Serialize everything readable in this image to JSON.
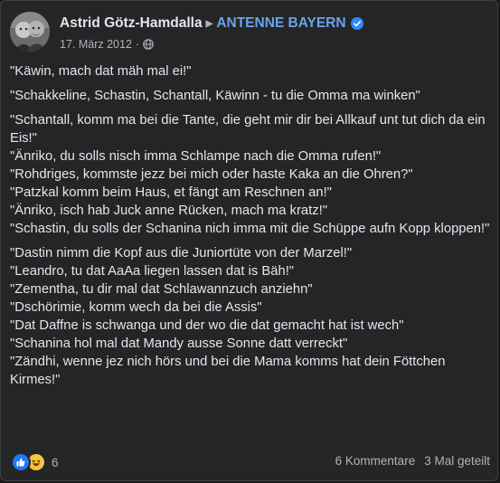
{
  "post": {
    "author": "Astrid Götz-Hamdalla",
    "target_page": "ANTENNE BAYERN",
    "date": "17. März 2012",
    "separator": "·",
    "arrow_icon": "triangle-right-icon",
    "verified_icon": "verified-badge-icon",
    "privacy_icon": "globe-icon",
    "colors": {
      "background": "#242526",
      "text": "#e4e6eb",
      "secondary_text": "#b0b3b8",
      "page_link": "#6aa3e8",
      "verified": "#2d88ff"
    }
  },
  "content": {
    "lines": [
      "\"Käwin, mach dat mäh mal ei!\"",
      "\"Schakkeline, Schastin, Schantall, Käwinn - tu die Omma ma winken\"",
      "\"Schantall, komm ma bei die Tante, die geht mir dir bei Allkauf unt tut dich da ein Eis!\"",
      "\"Änriko, du solls nisch imma Schlampe nach die Omma rufen!\"",
      "\"Rohdriges, kommste jezz bei mich oder haste Kaka an die Ohren?\"",
      "\"Patzkal komm beim Haus, et fängt am Reschnen an!\"",
      "\"Änriko, isch hab Juck anne Rücken, mach ma kratz!\"",
      "\"Schastin, du solls der Schanina nich imma mit die Schüppe aufn Kopp kloppen!\"",
      "\"Dastin nimm die Kopf aus die Juniortüte von der Marzel!\"",
      "\"Leandro, tu dat AaAa liegen lassen dat is Bäh!\"",
      "\"Zementha, tu dir mal dat Schlawannzuch anziehn\"",
      "\"Dschörimie, komm wech da bei die Assis\"",
      "\"Dat Daffne is schwanga und der wo die dat gemacht hat ist wech\"",
      "\"Schanina hol mal dat Mandy ausse Sonne datt verreckt\"",
      "\"Zändhi, wenne jez nich hörs und bei die Mama komms hat dein Föttchen Kirmes!\""
    ]
  },
  "footer": {
    "reaction_icons": [
      "like-icon",
      "haha-icon"
    ],
    "reaction_count": "6",
    "comments": "6 Kommentare",
    "shares": "3 Mal geteilt"
  }
}
